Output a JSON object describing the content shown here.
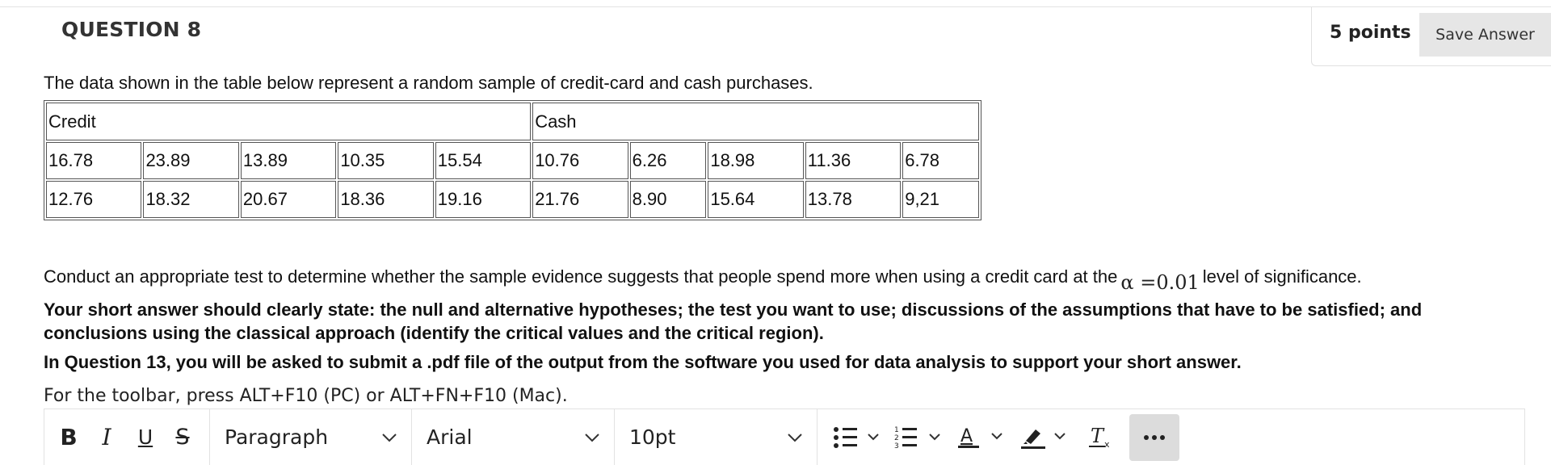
{
  "question": {
    "title": "QUESTION 8",
    "points": "5 points",
    "save_label": "Save Answer"
  },
  "intro": "The data shown in the table below represent a random sample of credit-card and cash purchases.",
  "table": {
    "headers": [
      "Credit",
      "Cash"
    ],
    "rows": [
      [
        "16.78",
        "23.89",
        "13.89",
        "10.35",
        "15.54",
        "10.76",
        "6.26",
        "18.98",
        "11.36",
        "6.78"
      ],
      [
        "12.76",
        "18.32",
        "20.67",
        "18.36",
        "19.16",
        "21.76",
        "8.90",
        "15.64",
        "13.78",
        "9,21"
      ]
    ]
  },
  "conduct": {
    "before": "Conduct an appropriate test to determine whether the sample evidence suggests that people spend more when using a credit card at the",
    "alpha": "α =0.01",
    "after": "level of significance."
  },
  "instructions": {
    "line1": "Your short answer should clearly state: the null and alternative hypotheses; the test you want to use; discussions of the assumptions that have to be satisfied; and conclusions using the classical approach (identify the critical values and the critical region).",
    "line2": "In Question 13, you will be asked to submit a .pdf file of the output from the software you used for data analysis to support your short answer."
  },
  "toolbar": {
    "note": "For the toolbar, press ALT+F10 (PC) or ALT+FN+F10 (Mac).",
    "bold": "B",
    "italic": "I",
    "underline": "U",
    "strike": "S",
    "paragraph": "Paragraph",
    "font": "Arial",
    "size": "10pt",
    "icons": [
      "bullet-list-icon",
      "numbered-list-icon",
      "text-color-icon",
      "highlight-icon",
      "clear-format-icon",
      "more-icon"
    ]
  }
}
